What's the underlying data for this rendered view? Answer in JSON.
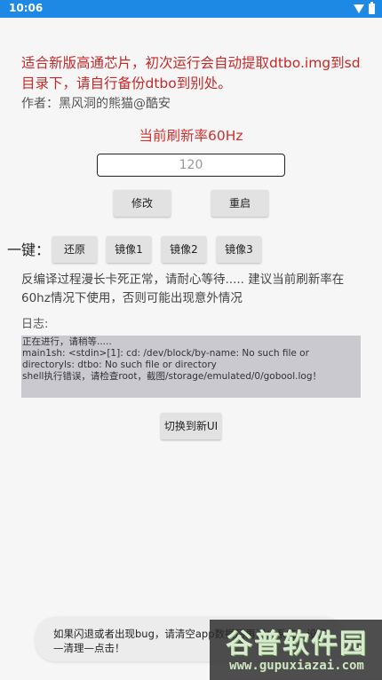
{
  "status_bar": {
    "time": "10:06"
  },
  "notice": {
    "text": "适合新版高通芯片，初次运行会自动提取dtbo.img到sd目录下，请自行备份dtbo到别处。",
    "author": "作者：黑风洞的熊猫@酷安"
  },
  "refresh": {
    "current_label": "当前刷新率60Hz",
    "input_value": "120",
    "modify_label": "修改",
    "restart_label": "重启"
  },
  "one_key": {
    "label": "一键：",
    "buttons": [
      "还原",
      "镜像1",
      "镜像2",
      "镜像3"
    ]
  },
  "warning_text": "反编译过程漫长卡死正常，请耐心等待..... 建议当前刷新率在60hz情况下使用，否则可能出现意外情况",
  "log": {
    "title": "日志:",
    "lines": [
      "正在进行，请稍等.....",
      "main1sh: <stdin>[1]: cd: /dev/block/by-name: No such file or directoryls: dtbo: No such file or directory",
      "shell执行错误，请检查root，截图/storage/emulated/0/gobool.log！"
    ]
  },
  "switch_ui_label": "切换到新UI",
  "toast": {
    "text": "如果闪退或者出现bug，请清空app数据后再试：系统—设置—清理—点击！"
  },
  "watermark": {
    "logo": "谷普软件园",
    "url": "www.gupuxiazai.com"
  }
}
